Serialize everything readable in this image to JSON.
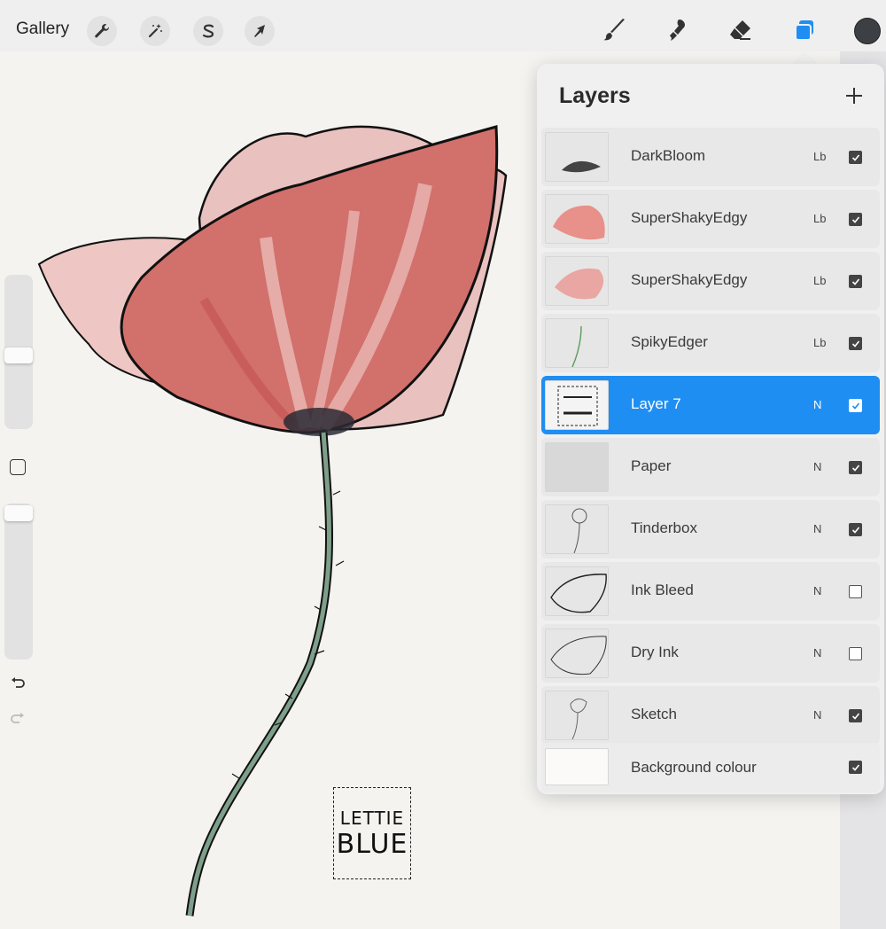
{
  "toolbar": {
    "gallery_label": "Gallery",
    "left_tools": [
      {
        "name": "wrench-icon"
      },
      {
        "name": "magic-wand-icon"
      },
      {
        "name": "selection-s-icon"
      },
      {
        "name": "transform-arrow-icon"
      }
    ],
    "right_tools": [
      {
        "name": "brush-icon"
      },
      {
        "name": "smudge-icon"
      },
      {
        "name": "eraser-icon"
      },
      {
        "name": "layers-icon",
        "active": true
      }
    ],
    "active_color": "#3c3f44",
    "accent": "#1f8ef2"
  },
  "sidebar": {
    "undo_icon": "undo-icon",
    "redo_icon": "redo-icon",
    "modify_icon": "modify-square-icon"
  },
  "artwork": {
    "signature_lines": [
      "LETTIE",
      "BLUE"
    ]
  },
  "layers_panel": {
    "title": "Layers",
    "add_icon": "plus-icon",
    "layers": [
      {
        "name": "DarkBloom",
        "blend": "Lb",
        "visible": true,
        "selected": false
      },
      {
        "name": "SuperShakyEdgy",
        "blend": "Lb",
        "visible": true,
        "selected": false
      },
      {
        "name": "SuperShakyEdgy",
        "blend": "Lb",
        "visible": true,
        "selected": false
      },
      {
        "name": "SpikyEdger",
        "blend": "Lb",
        "visible": true,
        "selected": false
      },
      {
        "name": "Layer 7",
        "blend": "N",
        "visible": true,
        "selected": true
      },
      {
        "name": "Paper",
        "blend": "N",
        "visible": true,
        "selected": false
      },
      {
        "name": "Tinderbox",
        "blend": "N",
        "visible": true,
        "selected": false
      },
      {
        "name": "Ink Bleed",
        "blend": "N",
        "visible": false,
        "selected": false
      },
      {
        "name": "Dry Ink",
        "blend": "N",
        "visible": false,
        "selected": false
      },
      {
        "name": "Sketch",
        "blend": "N",
        "visible": true,
        "selected": false
      },
      {
        "name": "Background colour",
        "blend": "",
        "visible": true,
        "selected": false
      }
    ]
  }
}
